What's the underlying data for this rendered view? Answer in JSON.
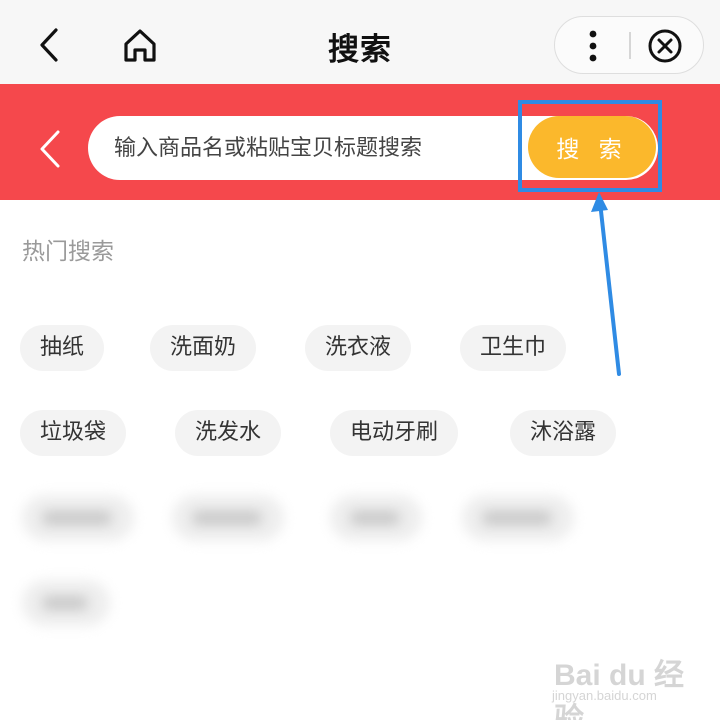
{
  "navbar": {
    "title": "搜索",
    "back_icon": "chevron-left-icon",
    "home_icon": "home-icon",
    "more_icon": "more-vertical-icon",
    "close_icon": "close-circle-icon"
  },
  "search": {
    "placeholder": "输入商品名或粘贴宝贝标题搜索",
    "button_label": "搜 索",
    "band_color": "#f5484c",
    "button_color": "#fbb82c"
  },
  "hot_searches": {
    "title": "热门搜索",
    "tags": [
      "抽纸",
      "洗面奶",
      "洗衣液",
      "卫生巾",
      "垃圾袋",
      "洗发水",
      "电动牙刷",
      "沐浴露"
    ]
  },
  "annotation": {
    "color": "#2f8be4"
  },
  "watermark": {
    "main": "Bai du 经验",
    "sub": "jingyan.baidu.com"
  }
}
